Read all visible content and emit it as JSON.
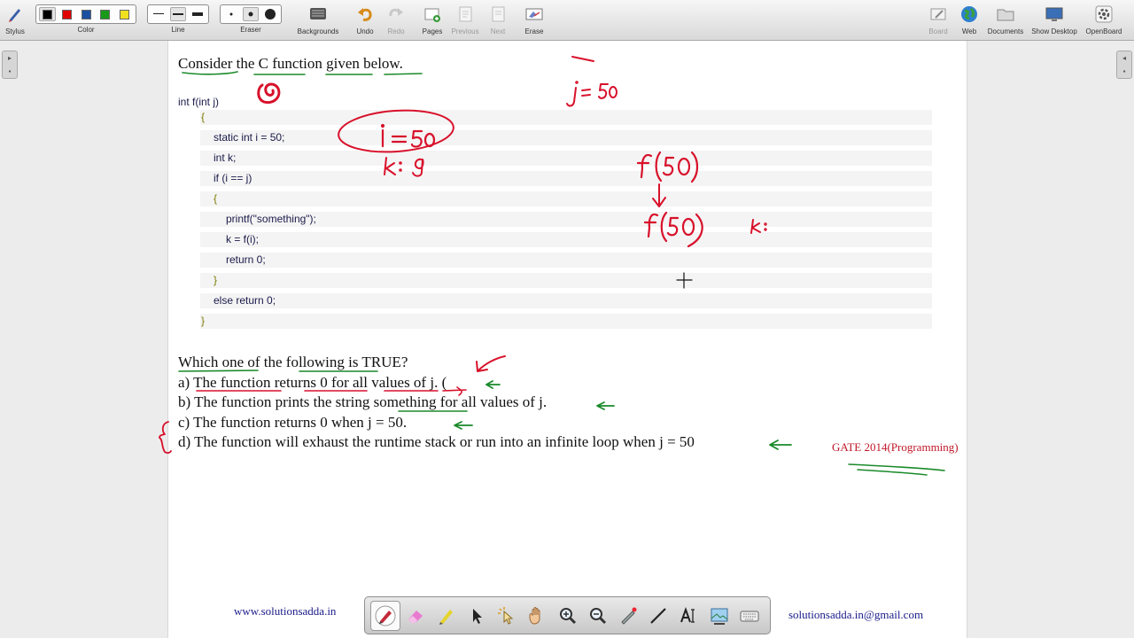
{
  "toolbar": {
    "left_items": [
      {
        "label": "Stylus",
        "icon": "stylus-icon"
      },
      {
        "label": "Color",
        "icon": "color-palette"
      },
      {
        "label": "Line",
        "icon": "line-width-icon"
      },
      {
        "label": "Eraser",
        "icon": "eraser-size-icon"
      },
      {
        "label": "Backgrounds",
        "icon": "backgrounds-icon"
      },
      {
        "label": "Undo",
        "icon": "undo-icon"
      },
      {
        "label": "Redo",
        "icon": "redo-icon"
      },
      {
        "label": "Pages",
        "icon": "pages-icon"
      },
      {
        "label": "Previous",
        "icon": "previous-icon"
      },
      {
        "label": "Next",
        "icon": "next-icon"
      },
      {
        "label": "Erase",
        "icon": "erase-icon"
      }
    ],
    "right_items": [
      {
        "label": "Board",
        "icon": "board-icon"
      },
      {
        "label": "Web",
        "icon": "web-globe-icon"
      },
      {
        "label": "Documents",
        "icon": "documents-folder-icon"
      },
      {
        "label": "Show Desktop",
        "icon": "show-desktop-icon"
      },
      {
        "label": "OpenBoard",
        "icon": "openboard-gear-icon"
      }
    ],
    "colors": [
      "#000000",
      "#e00000",
      "#1a4fa0",
      "#1a9a1a",
      "#f0e020"
    ]
  },
  "question": {
    "title": "Consider the C function given below.",
    "code": [
      "int f(int j)",
      "{",
      "static int i = 50;",
      "int k;",
      "if (i == j)",
      "{",
      "printf(\"something\");",
      "k = f(i);",
      "return 0;",
      "}",
      "else return 0;",
      "}"
    ],
    "prompt": "Which one of the following is TRUE?",
    "options": [
      "a) The function returns 0 for all values of j. (",
      "b) The function prints the string something for all values of j.",
      "c) The function returns 0 when j = 50.",
      "d) The function will exhaust the runtime stack or run into an infinite loop when j = 50"
    ],
    "source": "GATE 2014(Programming)"
  },
  "footer": {
    "website": "www.solutionsadda.in",
    "email": "solutionsadda.in@gmail.com"
  },
  "bottom_tools": [
    "pen-icon",
    "highlighter-eraser-icon",
    "marker-icon",
    "pointer-arrow-icon",
    "laser-pointer-icon",
    "hand-pan-icon",
    "zoom-in-icon",
    "zoom-out-icon",
    "pointer-pen-icon",
    "line-tool-icon",
    "text-tool-icon",
    "capture-icon",
    "virtual-keyboard-icon"
  ],
  "ink": {
    "red": "#d8112b",
    "green": "#1a8a2a"
  }
}
